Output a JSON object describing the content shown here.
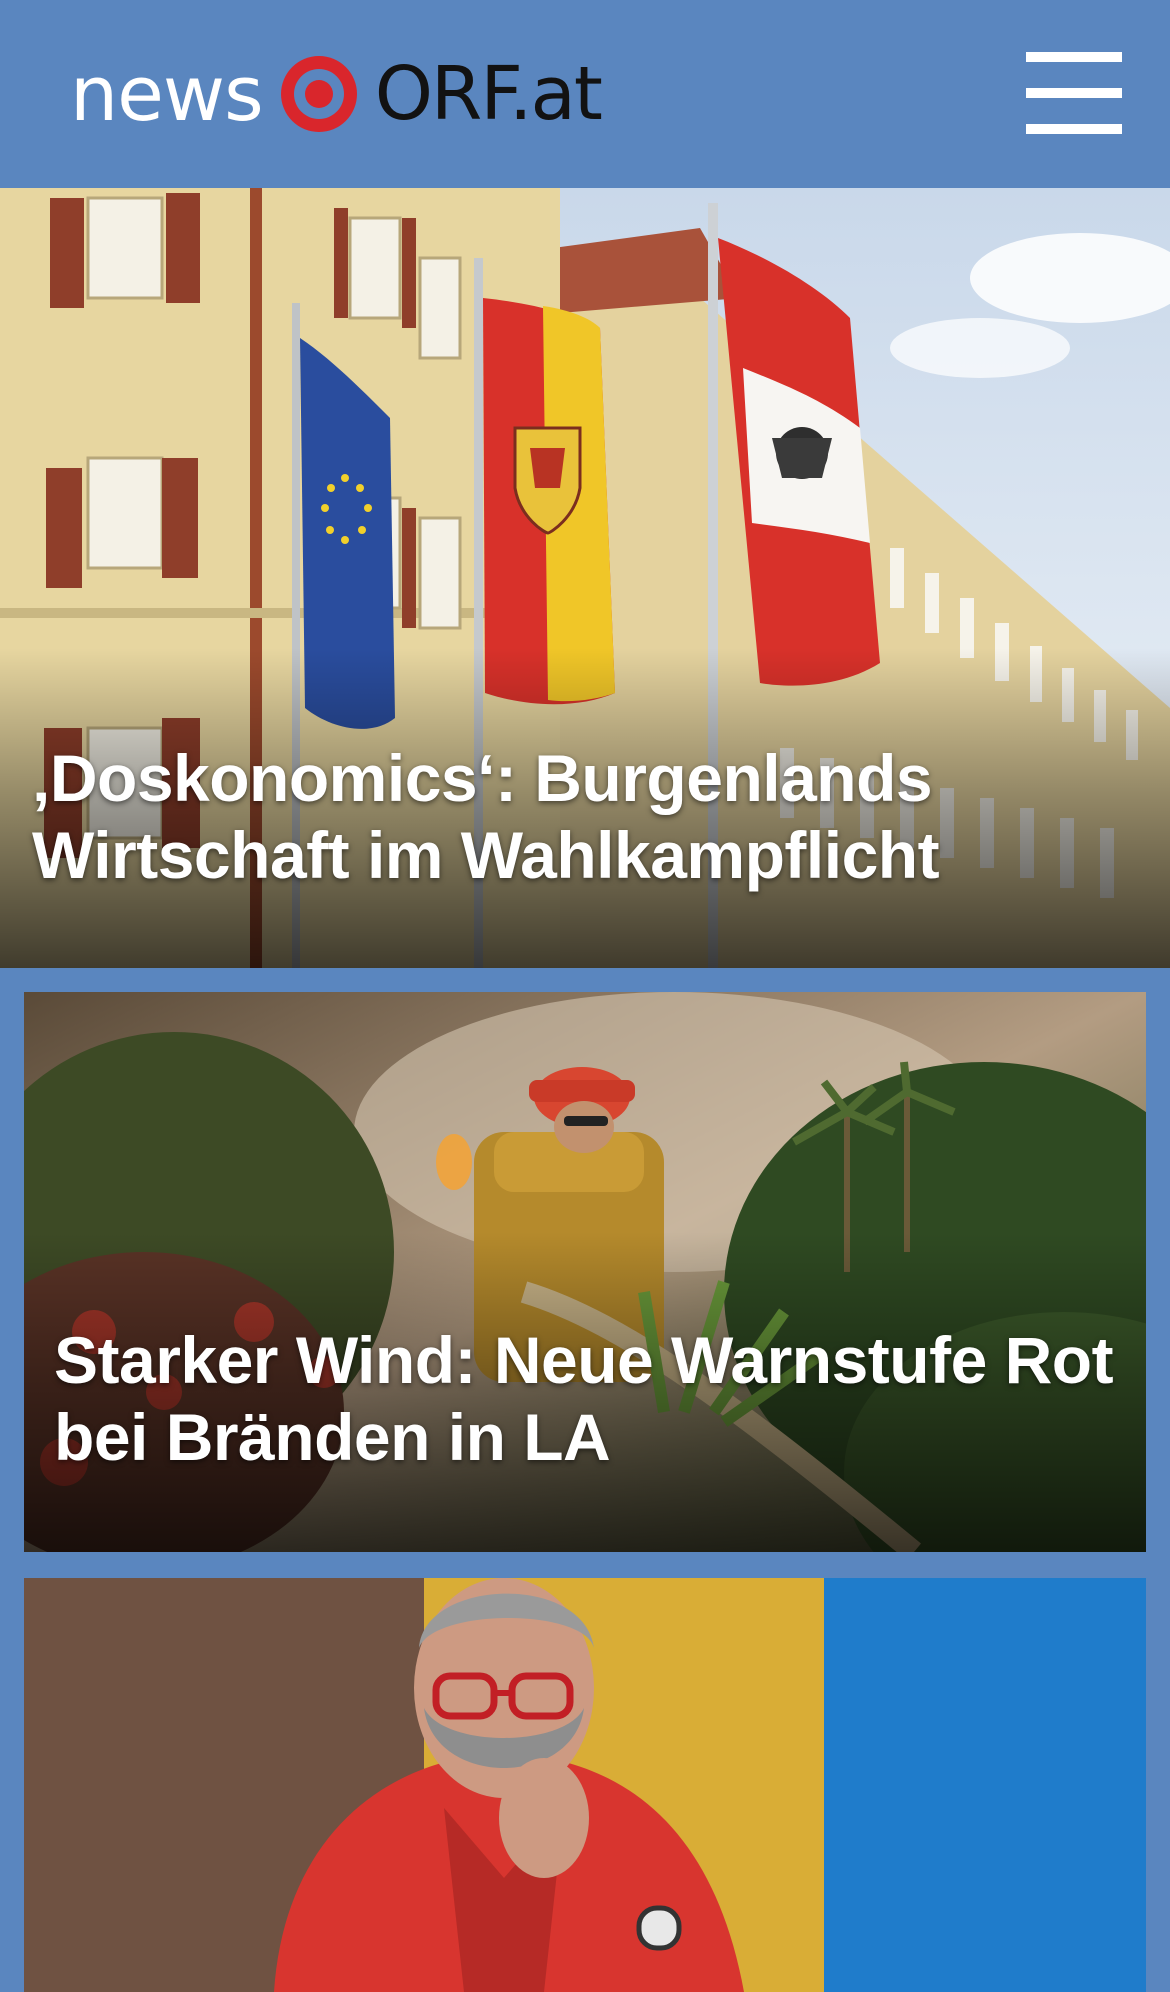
{
  "header": {
    "logo_news": "news",
    "logo_orf": "ORF.at",
    "menu_icon": "hamburger-menu-icon",
    "background_color": "#5a86bf"
  },
  "articles": [
    {
      "headline": "‚Doskonomics‘: Burgenlands\nWirtschaft im Wahlkampflicht"
    },
    {
      "headline": "Starker Wind: Neue Warnstufe Rot\nbei Bränden in LA"
    },
    {
      "headline": ""
    }
  ],
  "colors": {
    "brand_blue": "#5a86bf",
    "orf_red": "#d9262c"
  }
}
